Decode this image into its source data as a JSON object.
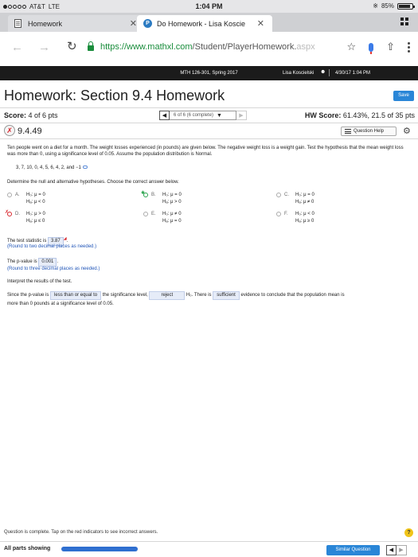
{
  "status_bar": {
    "carrier": "AT&T",
    "network": "LTE",
    "time": "1:04 PM",
    "battery": "85%",
    "battery_level": 0.85
  },
  "browser": {
    "tabs": [
      {
        "title": "Homework",
        "active": false
      },
      {
        "title": "Do Homework - Lisa Koscie",
        "active": true
      }
    ],
    "url_host": "https://www.mathxl.com",
    "url_path": "/Student/PlayerHomework.",
    "url_fade": "aspx"
  },
  "banner": {
    "course": "MTH 126-301, Spring 2017",
    "user": "Lisa Koscielski",
    "datetime": "4/30/17 1:04 PM"
  },
  "header": {
    "title": "Homework: Section 9.4 Homework",
    "save_label": "Save",
    "score_label": "Score:",
    "score_value": "4 of 6 pts",
    "question_select": "6 of 6 (6 complete)",
    "hw_score_label": "HW Score:",
    "hw_score_value": "61.43%, 21.5 of 35 pts"
  },
  "question": {
    "number": "9.4.49",
    "help_label": "Question Help",
    "problem": "Ten people went on a diet for a month. The weight losses experienced (in pounds) are given below. The negative weight loss is a weight gain. Test the hypothesis that the mean weight loss was more than 0, using a significance level of 0.05. Assume the population distribution is Normal.",
    "data": "3, 7, 10, 0, 4, 5, 6, 4, 2, and −1",
    "instruction": "Determine the null and alternative hypotheses. Choose the correct answer below.",
    "options": [
      {
        "letter": "A.",
        "h0": "H₀: μ = 0",
        "ha": "Hₐ: μ < 0"
      },
      {
        "letter": "B.",
        "h0": "H₀: μ = 0",
        "ha": "Hₐ: μ > 0"
      },
      {
        "letter": "C.",
        "h0": "H₀: μ = 0",
        "ha": "Hₐ: μ ≠ 0"
      },
      {
        "letter": "D.",
        "h0": "H₀: μ > 0",
        "ha": "Hₐ: μ ≤ 0"
      },
      {
        "letter": "E.",
        "h0": "H₀: μ ≠ 0",
        "ha": "Hₐ: μ = 0"
      },
      {
        "letter": "F.",
        "h0": "H₀: μ < 0",
        "ha": "Hₐ: μ ≥ 0"
      }
    ],
    "stat_label": "The test statistic is",
    "stat_value": "3.87",
    "stat_hint": "(Round to two decimal places as needed.)",
    "pval_label": "The p-value is",
    "pval_value": "0.001",
    "pval_hint": "(Round to three decimal places as needed.)",
    "interpret": "Interpret the results of the test.",
    "concl_1": "Since the p-value is",
    "concl_sel1": "less than or equal to",
    "concl_2": "the significance level,",
    "concl_sel2": "reject",
    "concl_3": "H₀. There is",
    "concl_sel3": "sufficient",
    "concl_4": "evidence to conclude that the population mean is",
    "concl_5": "more than 0 pounds at a significance level of 0.05."
  },
  "footer": {
    "complete_msg": "Question is complete. Tap on the red indicators to see incorrect answers.",
    "parts_label": "All parts showing",
    "parts_progress": 1.0,
    "similar_label": "Similar Question"
  }
}
